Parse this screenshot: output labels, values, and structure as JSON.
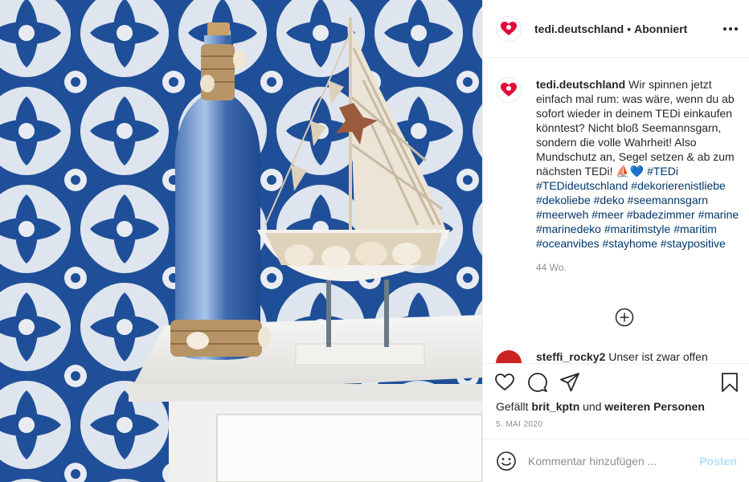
{
  "post": {
    "username": "tedi.deutschland",
    "separator": "•",
    "follow_status": "Abonniert",
    "more_icon": "more-horizontal-icon",
    "avatar_icon": "heart-logo-icon",
    "brand_color": "#e30b3a"
  },
  "caption": {
    "username": "tedi.deutschland",
    "text": "Wir spinnen jetzt einfach mal rum: was wäre, wenn du ab sofort wieder in deinem TEDi einkaufen könntest? Nicht bloß Seemannsgarn, sondern die volle Wahrheit! Also Mundschutz an, Segel setzen & ab zum nächsten TEDi! ⛵💙",
    "hashtags": [
      "#TEDi",
      "#TEDideutschland",
      "#dekorierenistliebe",
      "#dekoliebe",
      "#deko",
      "#seemannsgarn",
      "#meerweh",
      "#meer",
      "#badezimmer",
      "#marine",
      "#marinedeko",
      "#maritimstyle",
      "#maritim",
      "#oceanvibes",
      "#stayhome",
      "#staypositive"
    ],
    "age": "44 Wo."
  },
  "load_more": {
    "icon": "plus-circle-icon"
  },
  "comment": {
    "username": "steffi_rocky2",
    "text": "Unser ist zwar offen"
  },
  "actions": {
    "like_icon": "heart-icon",
    "comment_icon": "comment-icon",
    "share_icon": "send-icon",
    "save_icon": "bookmark-icon",
    "likes_prefix": "Gefällt",
    "liked_by": "brit_kptn",
    "likes_middle": "und",
    "likes_others": "weiteren Personen",
    "date": "5. MAI 2020"
  },
  "composer": {
    "emoji_icon": "smiley-icon",
    "placeholder": "Kommentar hinzufügen ...",
    "post_label": "Posten",
    "post_color": "#b2dffc"
  }
}
